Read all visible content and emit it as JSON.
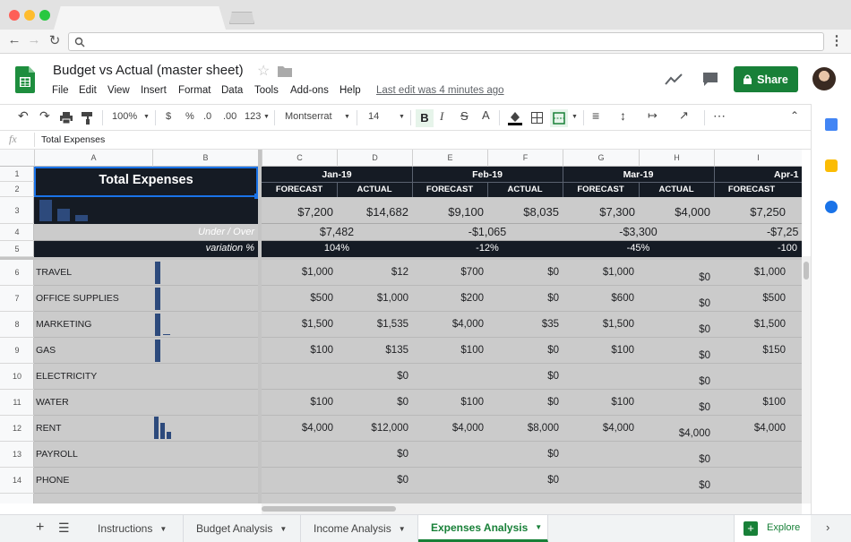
{
  "doc": {
    "title": "Budget vs Actual (master sheet)",
    "last_edit": "Last edit was 4 minutes ago",
    "share": "Share",
    "menus": [
      "File",
      "Edit",
      "View",
      "Insert",
      "Format",
      "Data",
      "Tools",
      "Add-ons",
      "Help"
    ]
  },
  "toolbar": {
    "zoom": "100%",
    "currency": "$",
    "percent": "%",
    "dec_less": ".0",
    "dec_more": ".00",
    "format": "123",
    "font": "Montserrat",
    "size": "14",
    "bold": "B",
    "italic": "I",
    "strike": "S",
    "text_color": "A"
  },
  "formula": {
    "fx": "fx",
    "value": "Total Expenses"
  },
  "columns": [
    "A",
    "B",
    "C",
    "D",
    "E",
    "F",
    "G",
    "H",
    "I"
  ],
  "rows": [
    "1",
    "2",
    "3",
    "4",
    "5",
    "6",
    "7",
    "8",
    "9",
    "10",
    "11",
    "12",
    "13",
    "14"
  ],
  "header": {
    "title": "Total Expenses",
    "months": [
      "Jan-19",
      "Feb-19",
      "Mar-19",
      "Apr-1"
    ],
    "sub": [
      "FORECAST",
      "ACTUAL",
      "FORECAST",
      "ACTUAL",
      "FORECAST",
      "ACTUAL",
      "FORECAST"
    ],
    "totals": [
      "$7,200",
      "$14,682",
      "$9,100",
      "$8,035",
      "$7,300",
      "$4,000",
      "$7,250"
    ],
    "under_over_label": "Under / Over",
    "under_over": [
      "$7,482",
      "-$1,065",
      "-$3,300",
      "-$7,25"
    ],
    "variation_label": "variation %",
    "variation": [
      "104%",
      "-12%",
      "-45%",
      "-100"
    ]
  },
  "expenses": [
    {
      "name": "TRAVEL",
      "vals": [
        "$1,000",
        "$12",
        "$700",
        "$0",
        "$1,000",
        "$0",
        "$1,000"
      ]
    },
    {
      "name": "OFFICE SUPPLIES",
      "vals": [
        "$500",
        "$1,000",
        "$200",
        "$0",
        "$600",
        "$0",
        "$500"
      ]
    },
    {
      "name": "MARKETING",
      "vals": [
        "$1,500",
        "$1,535",
        "$4,000",
        "$35",
        "$1,500",
        "$0",
        "$1,500"
      ]
    },
    {
      "name": "GAS",
      "vals": [
        "$100",
        "$135",
        "$100",
        "$0",
        "$100",
        "$0",
        "$150"
      ]
    },
    {
      "name": "ELECTRICITY",
      "vals": [
        "",
        "$0",
        "",
        "$0",
        "",
        "$0",
        ""
      ]
    },
    {
      "name": "WATER",
      "vals": [
        "$100",
        "$0",
        "$100",
        "$0",
        "$100",
        "$0",
        "$100"
      ]
    },
    {
      "name": "RENT",
      "vals": [
        "$4,000",
        "$12,000",
        "$4,000",
        "$8,000",
        "$4,000",
        "$4,000",
        "$4,000"
      ]
    },
    {
      "name": "PAYROLL",
      "vals": [
        "",
        "$0",
        "",
        "$0",
        "",
        "$0",
        ""
      ]
    },
    {
      "name": "PHONE",
      "vals": [
        "",
        "$0",
        "",
        "$0",
        "",
        "$0",
        ""
      ]
    }
  ],
  "sheets": {
    "instructions": "Instructions",
    "budget": "Budget Analysis",
    "income": "Income Analysis",
    "expenses": "Expenses Analysis"
  },
  "explore": "Explore",
  "colors": {
    "dark_band": "#151b24",
    "grid_bg": "#cbcbcb",
    "bar": "#2d4a7c",
    "share": "#188038",
    "active_tab": "#188038"
  }
}
